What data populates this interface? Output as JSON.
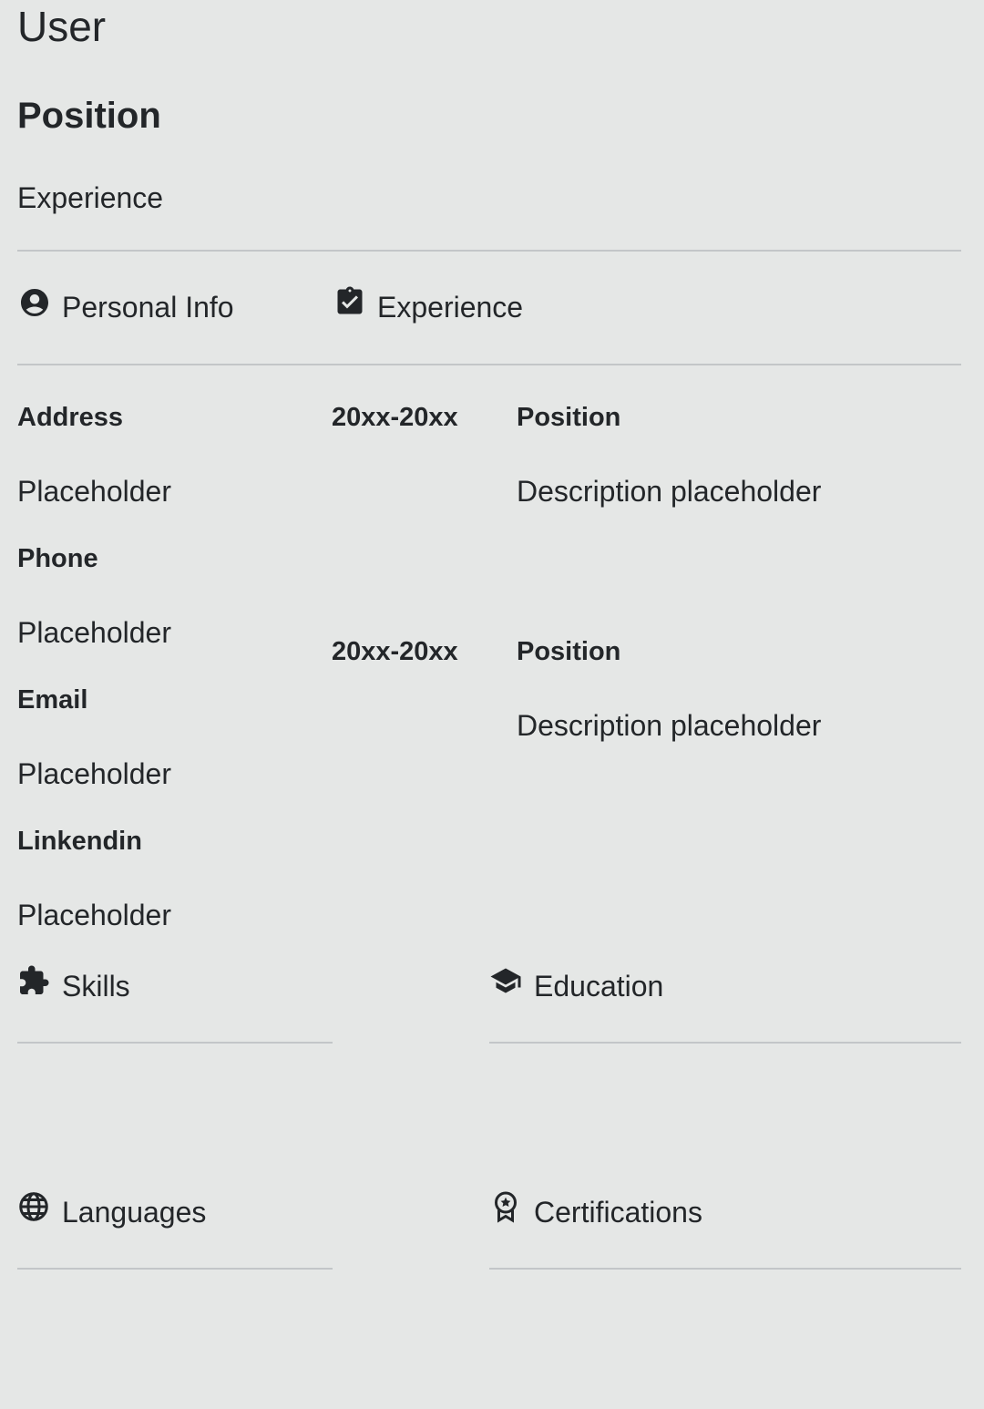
{
  "header": {
    "name": "User",
    "position": "Position",
    "experience": "Experience"
  },
  "sections": {
    "personal_info": {
      "label": "Personal Info",
      "icon": "account-circle-icon"
    },
    "experience": {
      "label": "Experience",
      "icon": "assignment-turned-in-icon"
    },
    "skills": {
      "label": "Skills",
      "icon": "puzzle-piece-icon"
    },
    "education": {
      "label": "Education",
      "icon": "graduation-cap-icon"
    },
    "languages": {
      "label": "Languages",
      "icon": "globe-icon"
    },
    "certifications": {
      "label": "Certifications",
      "icon": "award-ribbon-icon"
    }
  },
  "personal_info": {
    "fields": [
      {
        "label": "Address",
        "value": "Placeholder"
      },
      {
        "label": "Phone",
        "value": "Placeholder"
      },
      {
        "label": "Email",
        "value": "Placeholder"
      },
      {
        "label": "Linkendin",
        "value": "Placeholder"
      }
    ]
  },
  "experience": {
    "entries": [
      {
        "period": "20xx-20xx",
        "position": "Position",
        "description": "Description placeholder"
      },
      {
        "period": "20xx-20xx",
        "position": "Position",
        "description": "Description placeholder"
      }
    ]
  },
  "colors": {
    "background": "#e5e7e6",
    "text": "#232629",
    "divider": "#c3c6c8"
  }
}
